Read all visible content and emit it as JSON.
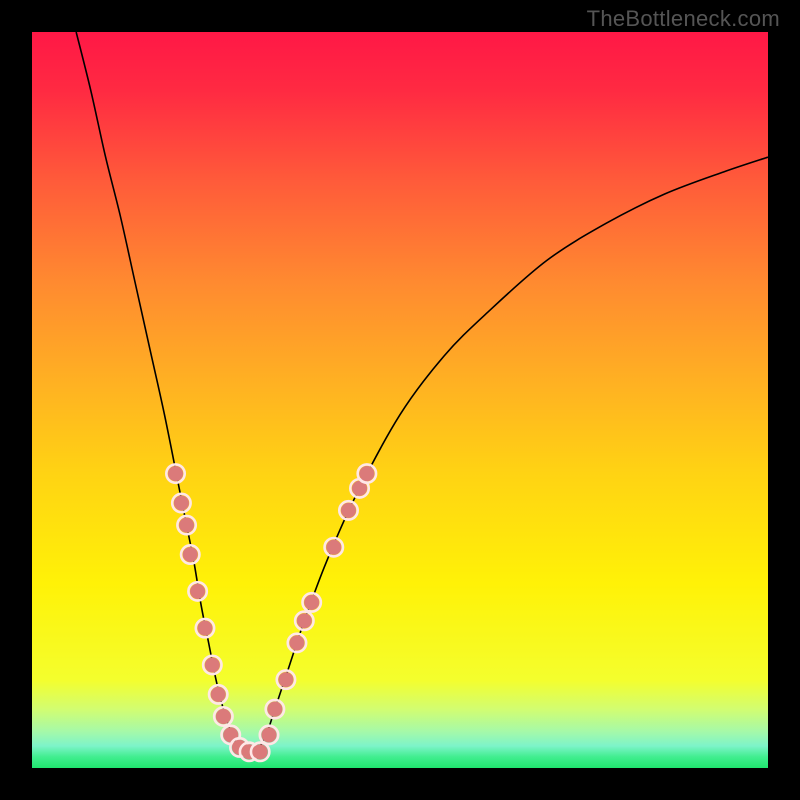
{
  "watermark": "TheBottleneck.com",
  "colors": {
    "dot_fill": "#db7a7a",
    "dot_ring": "#ffe7e7",
    "curve": "#000000",
    "frame_bg_top": "#ff1846",
    "frame_bg_bottom": "#1fe56e"
  },
  "chart_data": {
    "type": "line",
    "title": "",
    "xlabel": "",
    "ylabel": "",
    "xlim": [
      0,
      100
    ],
    "ylim": [
      0,
      100
    ],
    "grid": false,
    "legend": false,
    "series": [
      {
        "name": "curve",
        "x": [
          6,
          8,
          10,
          12,
          14,
          16,
          18,
          20,
          21,
          22,
          23,
          24,
          25,
          26,
          27,
          28,
          29,
          30,
          31,
          32,
          33,
          35,
          37,
          40,
          44,
          50,
          56,
          62,
          70,
          78,
          86,
          94,
          100
        ],
        "y": [
          100,
          92,
          83,
          75,
          66,
          57,
          48,
          38,
          33,
          28,
          22,
          17,
          12,
          8,
          5,
          3,
          2,
          2,
          3,
          5,
          8,
          14,
          20,
          28,
          37,
          48,
          56,
          62,
          69,
          74,
          78,
          81,
          83
        ]
      }
    ],
    "markers": {
      "name": "highlight-points",
      "points": [
        {
          "x": 19.5,
          "y": 40
        },
        {
          "x": 20.3,
          "y": 36
        },
        {
          "x": 21.0,
          "y": 33
        },
        {
          "x": 21.5,
          "y": 29
        },
        {
          "x": 22.5,
          "y": 24
        },
        {
          "x": 23.5,
          "y": 19
        },
        {
          "x": 24.5,
          "y": 14
        },
        {
          "x": 25.3,
          "y": 10
        },
        {
          "x": 26.0,
          "y": 7
        },
        {
          "x": 27.0,
          "y": 4.5
        },
        {
          "x": 28.2,
          "y": 2.8
        },
        {
          "x": 29.5,
          "y": 2.2
        },
        {
          "x": 31.0,
          "y": 2.2
        },
        {
          "x": 32.2,
          "y": 4.5
        },
        {
          "x": 33.0,
          "y": 8
        },
        {
          "x": 34.5,
          "y": 12
        },
        {
          "x": 36.0,
          "y": 17
        },
        {
          "x": 37.0,
          "y": 20
        },
        {
          "x": 38.0,
          "y": 22.5
        },
        {
          "x": 41.0,
          "y": 30
        },
        {
          "x": 43.0,
          "y": 35
        },
        {
          "x": 44.5,
          "y": 38
        },
        {
          "x": 45.5,
          "y": 40
        }
      ]
    }
  }
}
